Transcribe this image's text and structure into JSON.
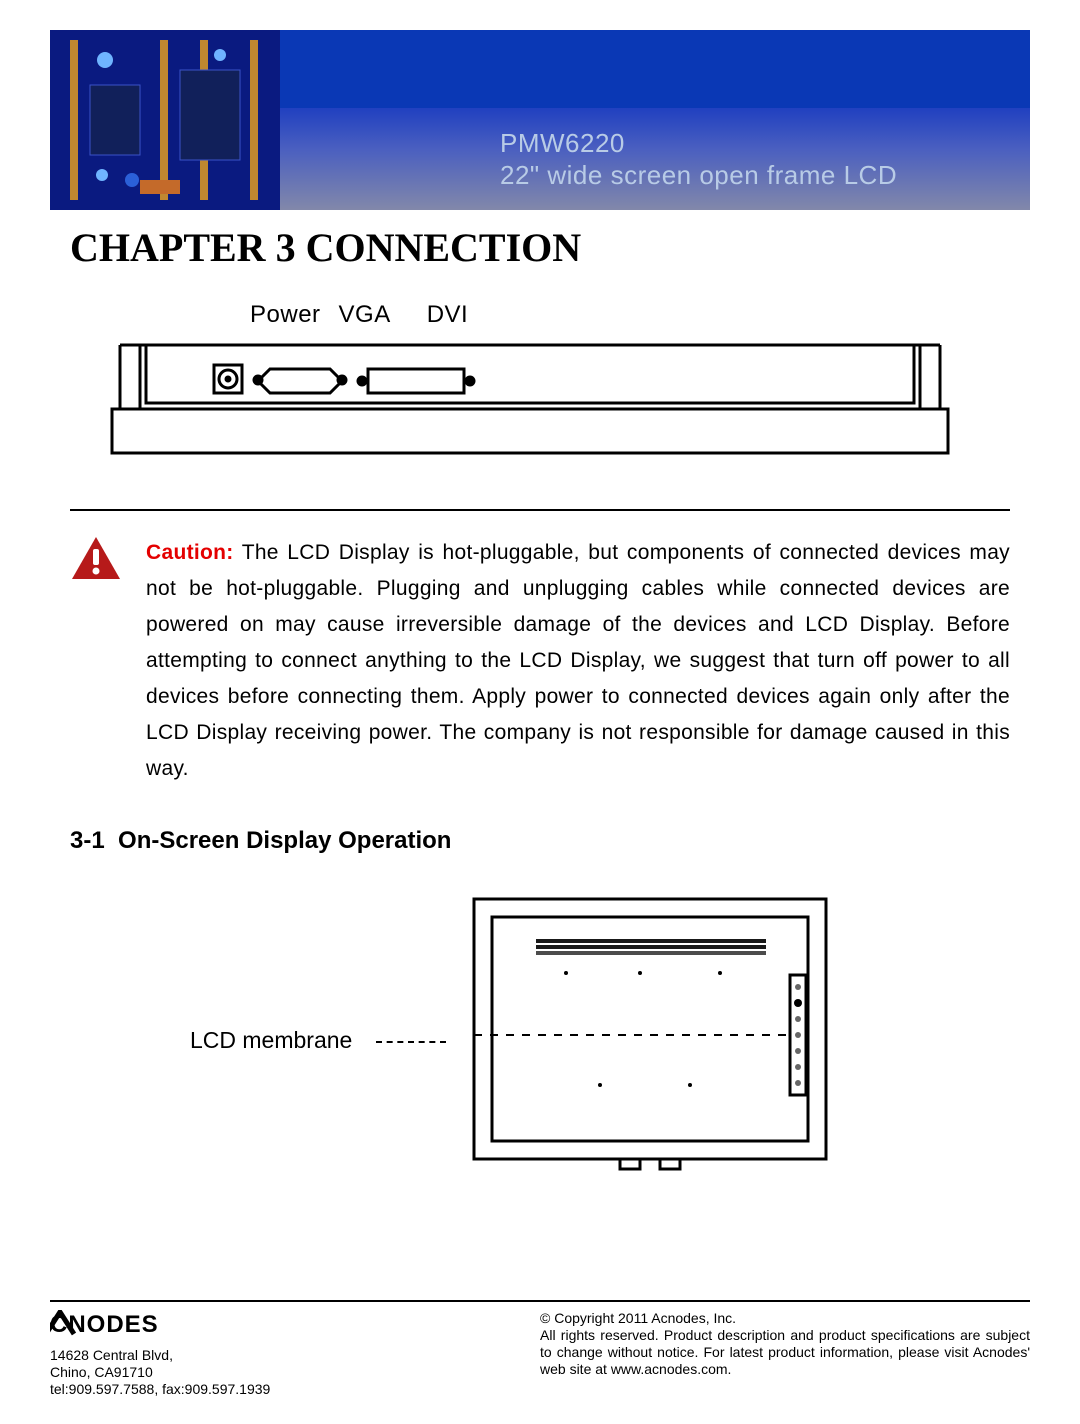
{
  "header": {
    "model": "PMW6220",
    "subtitle": "22\" wide screen open frame LCD"
  },
  "chapter_title": "CHAPTER 3 CONNECTION",
  "ports": {
    "labels": [
      "Power",
      "VGA",
      "DVI"
    ]
  },
  "caution": {
    "label": "Caution:",
    "text": "The LCD Display is hot-pluggable, but components of connected devices may not be hot-pluggable. Plugging and unplugging cables while connected devices are powered on may cause irreversible damage of the devices and LCD Display. Before attempting to connect anything to the LCD Display, we suggest that turn off power to all devices before connecting them. Apply power to connected devices again only after the LCD Display receiving power. The company is not responsible for damage caused in this way."
  },
  "section": {
    "number": "3-1",
    "title": "On-Screen Display Operation"
  },
  "osd": {
    "label": "LCD membrane"
  },
  "footer": {
    "brand": "ACNODES",
    "addr1": "14628 Central Blvd,",
    "addr2": "Chino, CA91710",
    "addr3": "tel:909.597.7588, fax:909.597.1939",
    "copy1": "© Copyright 2011 Acnodes, Inc.",
    "copy2": "All rights reserved. Product description and product specifications are subject to change without notice. For latest product information, please visit Acnodes' web site at www.acnodes.com."
  }
}
